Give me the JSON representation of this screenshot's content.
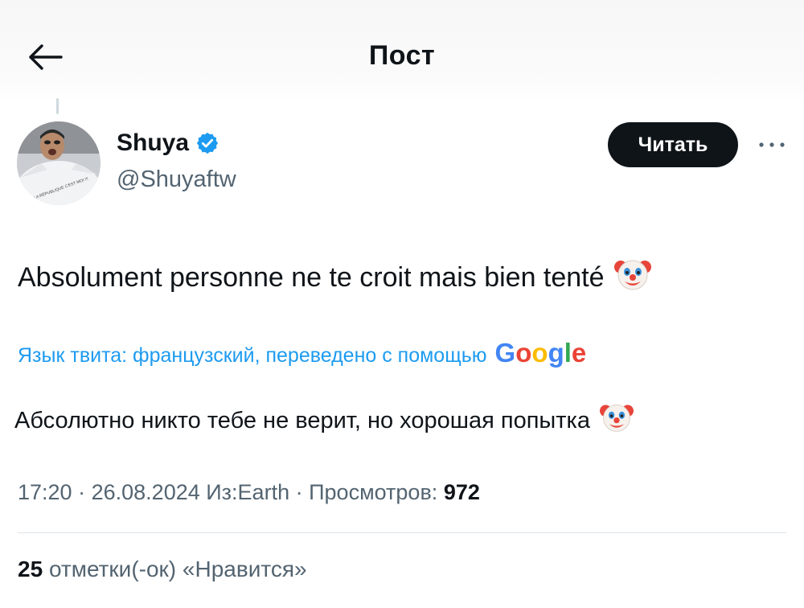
{
  "header": {
    "title": "Пост",
    "back_icon": "arrow-left-icon"
  },
  "author": {
    "display_name": "Shuya",
    "handle": "@Shuyaftw",
    "verified": true,
    "verified_color": "#1d9bf0",
    "avatar_shirt_text": "LA RÉPUBLIQUE C'EST MOI !!!"
  },
  "actions": {
    "follow_label": "Читать",
    "more_icon": "more-horizontal-icon"
  },
  "tweet": {
    "text": "Absolument personne ne te croit mais bien tenté",
    "emoji": "clown-face-emoji"
  },
  "translation": {
    "label": "Язык твита: французский, переведено с помощью",
    "provider": "Google",
    "text": "Абсолютно никто тебе не верит, но хорошая попытка"
  },
  "meta": {
    "time": "17:20",
    "separator": "·",
    "date": "26.08.2024",
    "source": "Из:Earth",
    "views_label": "Просмотров:",
    "views_count": "972"
  },
  "stats": {
    "likes_count": "25",
    "likes_label": "отметки(-ок) «Нравится»"
  },
  "colors": {
    "accent": "#1d9bf0",
    "text_primary": "#0f1419",
    "text_secondary": "#536471",
    "button_bg": "#0f1419"
  }
}
